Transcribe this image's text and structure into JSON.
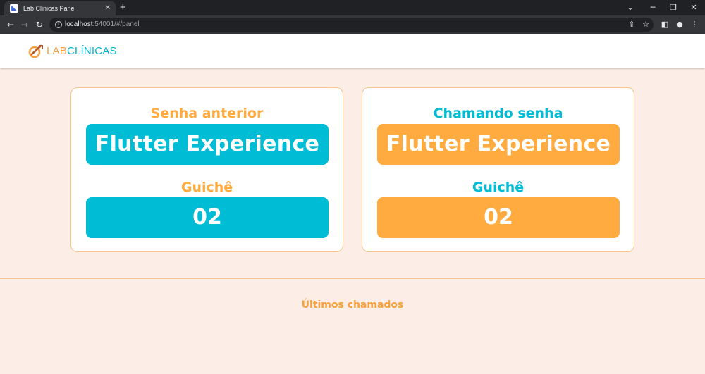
{
  "browser": {
    "tab_title": "Lab Clinicas Panel",
    "tab_favicon": "flutter-icon",
    "tab_close": "✕",
    "new_tab": "+",
    "url_host": "localhost",
    "url_rest": ":54001/#/panel",
    "icons": [
      "back-icon",
      "forward-icon",
      "reload-icon",
      "info-icon",
      "share-icon",
      "star-icon",
      "sidepanel-icon",
      "profile-icon",
      "menu-icon"
    ]
  },
  "app": {
    "logo_lab": "LAB",
    "logo_clinicas": "CLÍNICAS",
    "colors": {
      "accent_blue": "#00bcd4",
      "accent_orange": "#ffab40",
      "background": "#fcede6"
    }
  },
  "previous": {
    "heading": "Senha anterior",
    "password": "Flutter Experience",
    "desk_label": "Guichê",
    "desk_number": "02"
  },
  "current": {
    "heading": "Chamando senha",
    "password": "Flutter Experience",
    "desk_label": "Guichê",
    "desk_number": "02"
  },
  "recent": {
    "title": "Últimos chamados"
  }
}
